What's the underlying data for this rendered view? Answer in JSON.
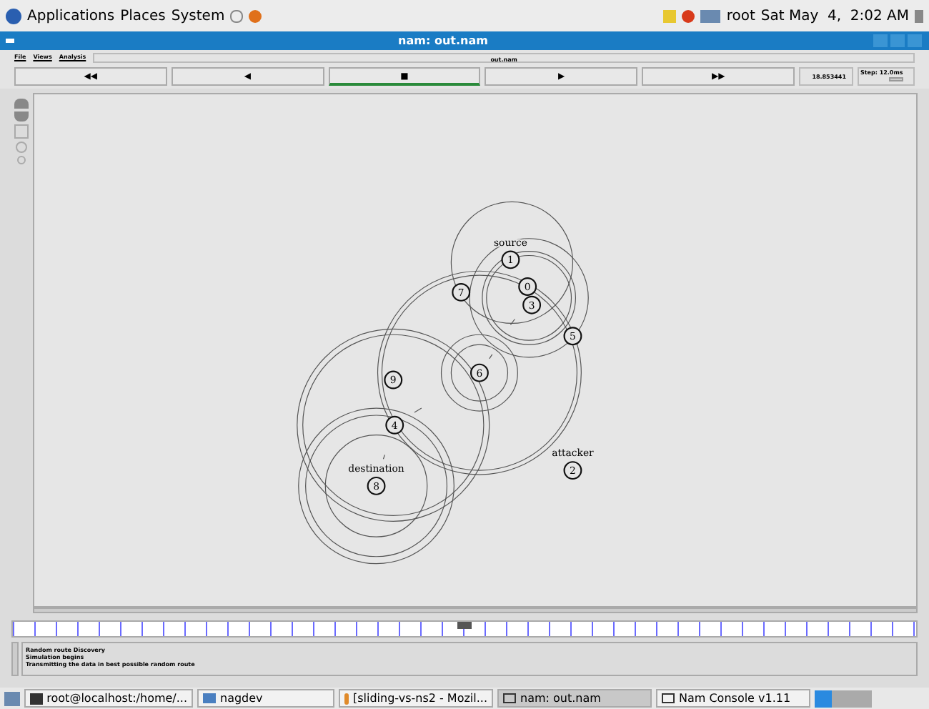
{
  "top_panel": {
    "menus": [
      "Applications",
      "Places",
      "System"
    ],
    "user": "root",
    "clock": "Sat May  4,  2:02 AM"
  },
  "window": {
    "title": "nam: out.nam"
  },
  "menu": [
    "File",
    "Views",
    "Analysis"
  ],
  "file_label": "out.nam",
  "controls": [
    {
      "symbol": "◀◀",
      "selected": false
    },
    {
      "symbol": "◀",
      "selected": false
    },
    {
      "symbol": "■",
      "selected": true
    },
    {
      "symbol": "▶",
      "selected": false
    },
    {
      "symbol": "▶▶",
      "selected": false
    }
  ],
  "time": "18.853441",
  "step": "Step: 12.0ms",
  "step_slider": {
    "level": 0.7
  },
  "nodes": [
    {
      "id": "1",
      "label": "source"
    },
    {
      "id": "7"
    },
    {
      "id": "0"
    },
    {
      "id": "3"
    },
    {
      "id": "5"
    },
    {
      "id": "6"
    },
    {
      "id": "9"
    },
    {
      "id": "4"
    },
    {
      "id": "8",
      "label": "destination"
    },
    {
      "id": "2",
      "label": "attacker"
    }
  ],
  "log": [
    "Random route Discovery",
    "Simulation begins",
    "Transmitting the data in best possible random route"
  ],
  "taskbar": [
    {
      "label": "root@localhost:/home/...",
      "kind": "terminal",
      "selected": false
    },
    {
      "label": "nagdev",
      "kind": "folder",
      "selected": false
    },
    {
      "label": "[sliding-vs-ns2 - Mozil...",
      "kind": "browser",
      "selected": false
    },
    {
      "label": "nam: out.nam",
      "kind": "window",
      "selected": true
    },
    {
      "label": "Nam Console v1.11",
      "kind": "window",
      "selected": false
    }
  ]
}
